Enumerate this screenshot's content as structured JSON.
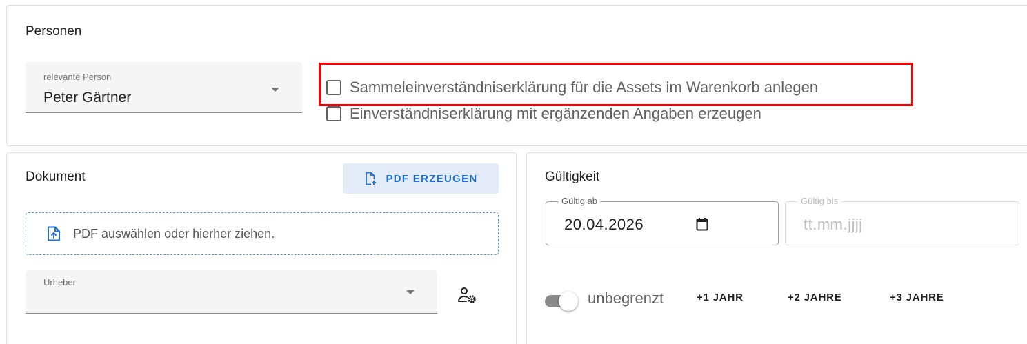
{
  "personen": {
    "title": "Personen",
    "person_select": {
      "label": "relevante Person",
      "value": "Peter Gärtner"
    },
    "checkboxes": [
      {
        "label": "Sammeleinverständniserklärung für die Assets im Warenkorb anlegen",
        "checked": false,
        "highlighted": true
      },
      {
        "label": "Einverständniserklärung mit ergänzenden Angaben erzeugen",
        "checked": false
      }
    ]
  },
  "dokument": {
    "title": "Dokument",
    "pdf_button": "PDF ERZEUGEN",
    "dropzone_text": "PDF auswählen oder hierher ziehen.",
    "urheber_select": {
      "label": "Urheber",
      "value": ""
    }
  },
  "gueltigkeit": {
    "title": "Gültigkeit",
    "gueltig_ab": {
      "label": "Gültig ab",
      "value": "20.04.2026"
    },
    "gueltig_bis": {
      "label": "Gültig bis",
      "placeholder": "tt.mm.jjjj",
      "disabled": true
    },
    "unbegrenzt": {
      "label": "unbegrenzt",
      "on": true
    },
    "quick_buttons": [
      "+1 JAHR",
      "+2 JAHRE",
      "+3 JAHRE"
    ]
  },
  "colors": {
    "accent": "#1e6fd0",
    "highlight": "#ff0000"
  }
}
